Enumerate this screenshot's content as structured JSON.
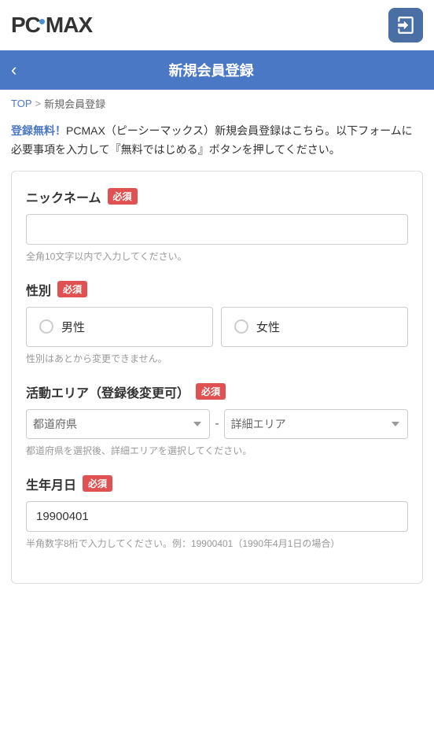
{
  "header": {
    "logo": "PCMAX",
    "login_button_aria": "ログイン"
  },
  "nav": {
    "back_label": "‹",
    "title": "新規会員登録"
  },
  "breadcrumb": {
    "top_label": "TOP",
    "separator": ">",
    "current": "新規会員登録"
  },
  "description": {
    "highlight": "登録無料！",
    "body": "PCMAX（ピーシーマックス）新規会員登録はこちら。以下フォームに必要事項を入力して『無料ではじめる』ボタンを押してください。"
  },
  "form": {
    "nickname": {
      "label": "ニックネーム",
      "required": "必須",
      "placeholder": "",
      "hint": "全角10文字以内で入力してください。"
    },
    "gender": {
      "label": "性別",
      "required": "必須",
      "options": [
        {
          "value": "male",
          "label": "男性"
        },
        {
          "value": "female",
          "label": "女性"
        }
      ],
      "hint": "性別はあとから変更できません。"
    },
    "area": {
      "label": "活動エリア（登録後変更可）",
      "required": "必須",
      "prefecture_placeholder": "都道府県",
      "detail_placeholder": "詳細エリア",
      "separator": "-",
      "hint": "都道府県を選択後、詳細エリアを選択してください。"
    },
    "birthday": {
      "label": "生年月日",
      "required": "必須",
      "value": "19900401",
      "hint": "半角数字8桁で入力してください。例：19900401（1990年4月1日の場合）"
    }
  }
}
